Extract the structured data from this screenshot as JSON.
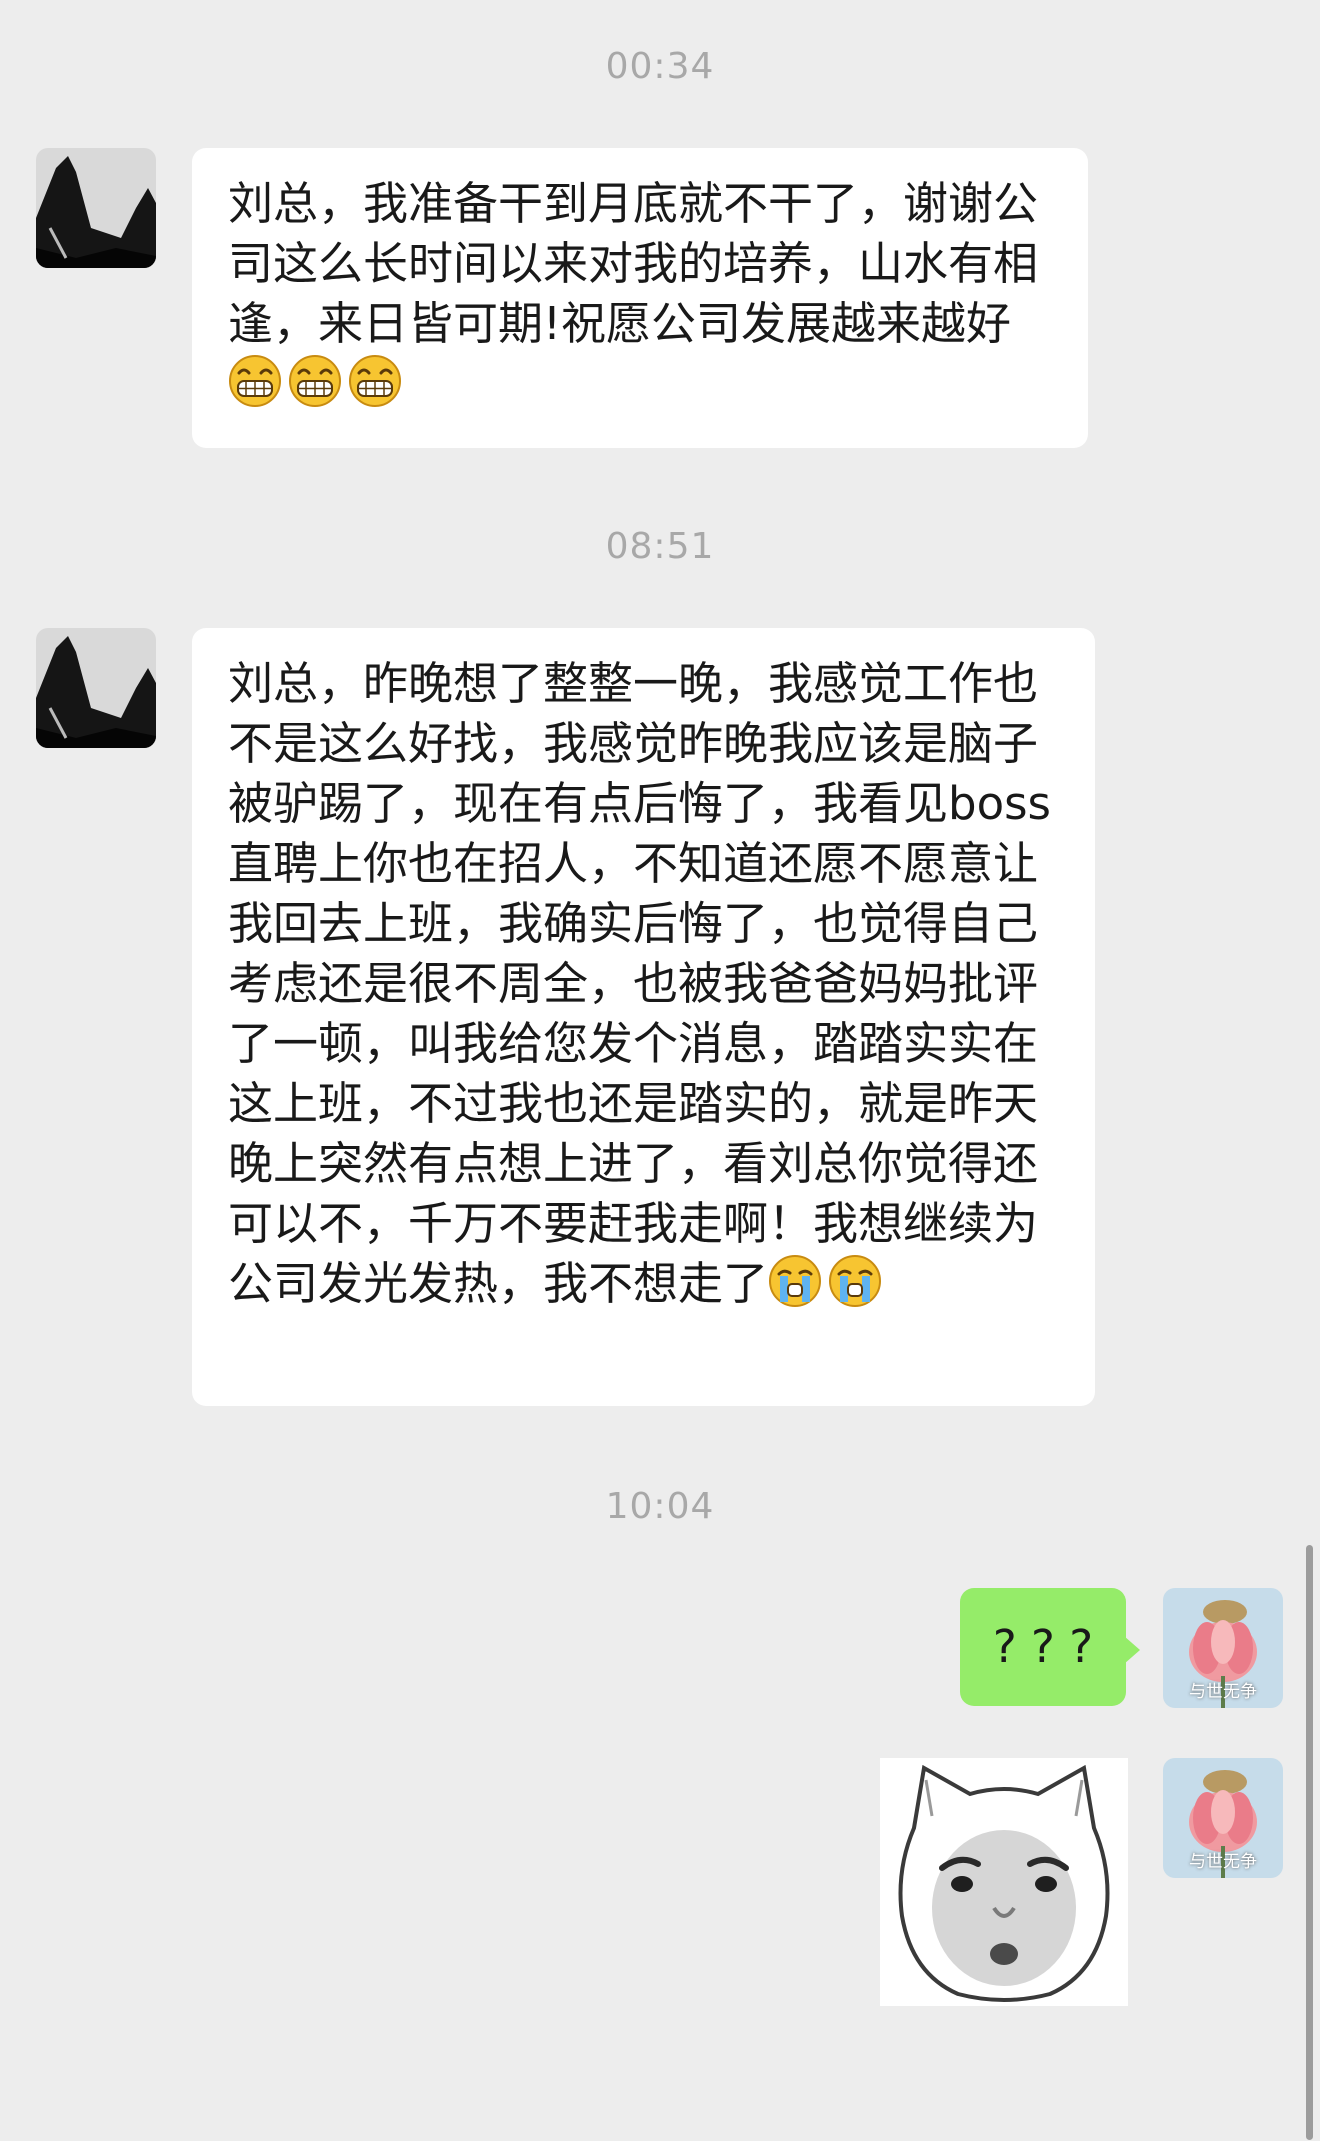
{
  "chat": {
    "time1": "00:34",
    "msg1": "刘总，我准备干到月底就不干了，谢谢公司这么长时间以来对我的培养，山水有相逢，来日皆可期!祝愿公司发展越来越好",
    "time2": "08:51",
    "msg2": "刘总，昨晚想了整整一晚，我感觉工作也不是这么好找，我感觉昨晚我应该是脑子被驴踢了，现在有点后悔了，我看见boss直聘上你也在招人，不知道还愿不愿意让我回去上班，我确实后悔了，也觉得自己考虑还是很不周全，也被我爸爸妈妈批评了一顿，叫我给您发个消息，踏踏实实在这上班，不过我也还是踏实的，就是昨天晚上突然有点想上进了，看刘总你觉得还可以不，千万不要赶我走啊！我想继续为公司发光发热，我不想走了",
    "time3": "10:04",
    "msg3": "? ? ?",
    "my_avatar_text": "与世无争",
    "emoji_grin": "grinning-face-emoji",
    "emoji_cry": "loudly-crying-face-emoji",
    "sticker": "shocked-face-sticker",
    "colors": {
      "background": "#ededed",
      "incoming_bubble": "#ffffff",
      "outgoing_bubble": "#95ec69",
      "timestamp": "#a8a8a8"
    }
  }
}
